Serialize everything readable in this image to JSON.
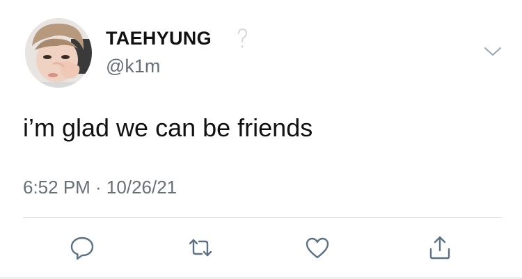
{
  "user": {
    "display_name": "TAEHYUNG",
    "handle": "@k1m",
    "badge_icon": "question-mark-icon"
  },
  "tweet": {
    "text": "i’m glad we can be friends",
    "timestamp": "6:52 PM · 10/26/21"
  },
  "actions": [
    {
      "name": "reply",
      "icon": "speech-bubble-icon"
    },
    {
      "name": "retweet",
      "icon": "retweet-arrows-icon"
    },
    {
      "name": "like",
      "icon": "heart-icon"
    },
    {
      "name": "share",
      "icon": "share-upload-icon"
    }
  ],
  "menu_icon": "chevron-down-icon",
  "colors": {
    "text": "#111111",
    "secondary": "#666f78",
    "icon": "#5b7083",
    "divider": "#dfe3e6"
  }
}
